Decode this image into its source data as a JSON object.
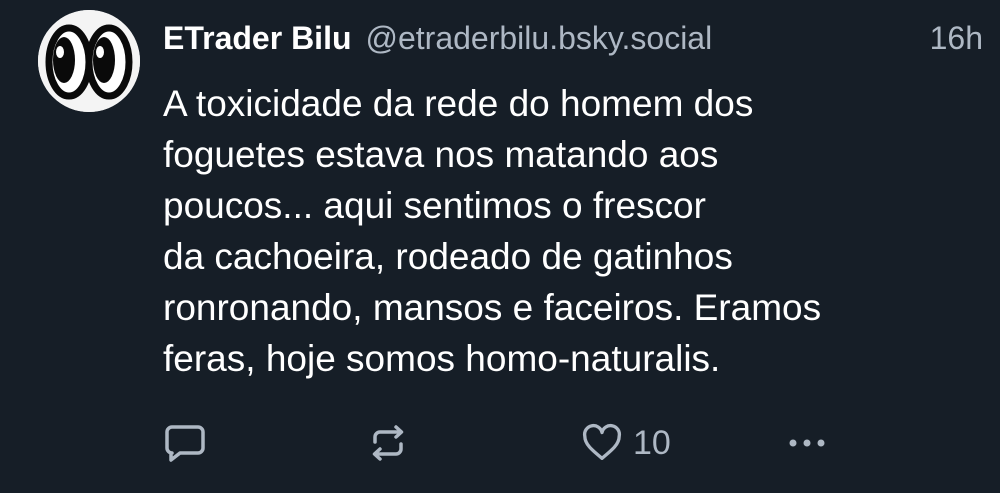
{
  "post": {
    "author": {
      "display_name": "ETrader Bilu",
      "handle": "@etraderbilu.bsky.social",
      "avatar_icon": "cartoon-eyes-avatar"
    },
    "timestamp": "16h",
    "text_lines": [
      "A toxicidade da rede do homem dos",
      "foguetes estava nos matando aos",
      "poucos... aqui sentimos o frescor",
      "da cachoeira, rodeado de gatinhos",
      "ronronando, mansos e faceiros. Eramos",
      "feras, hoje somos homo-naturalis."
    ],
    "actions": {
      "reply_icon": "speech-bubble-icon",
      "repost_icon": "repost-arrows-icon",
      "like_icon": "heart-icon",
      "like_count": "10",
      "more_icon": "ellipsis-icon"
    }
  },
  "colors": {
    "background": "#161e27",
    "text_primary": "#ffffff",
    "text_secondary": "#aeb8c4"
  }
}
